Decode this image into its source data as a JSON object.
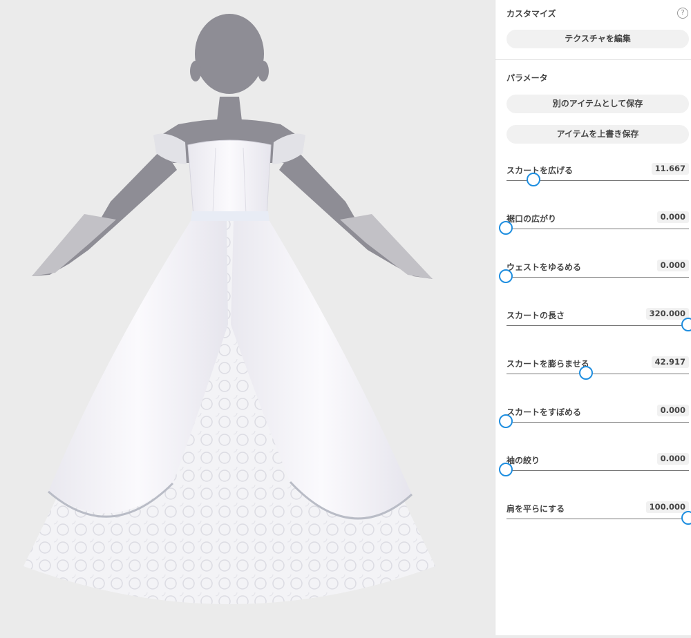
{
  "customize": {
    "title": "カスタマイズ",
    "help_glyph": "?",
    "edit_texture_label": "テクスチャを編集"
  },
  "parameters": {
    "title": "パラメータ",
    "save_as_new_label": "別のアイテムとして保存",
    "overwrite_label": "アイテムを上書き保存",
    "sliders": [
      {
        "label": "スカートを広げる",
        "value": "11.667",
        "fraction": 0.15
      },
      {
        "label": "裾口の広がり",
        "value": "0.000",
        "fraction": 0.0
      },
      {
        "label": "ウェストをゆるめる",
        "value": "0.000",
        "fraction": 0.0
      },
      {
        "label": "スカートの長さ",
        "value": "320.000",
        "fraction": 1.0
      },
      {
        "label": "スカートを膨らませる",
        "value": "42.917",
        "fraction": 0.44
      },
      {
        "label": "スカートをすぼめる",
        "value": "0.000",
        "fraction": 0.0
      },
      {
        "label": "袖の絞り",
        "value": "0.000",
        "fraction": 0.0
      },
      {
        "label": "肩を平らにする",
        "value": "100.000",
        "fraction": 1.0
      }
    ]
  },
  "colors": {
    "accent": "#1e8ee0",
    "body": "#8e8d95",
    "dress": "#f7f5fa"
  }
}
